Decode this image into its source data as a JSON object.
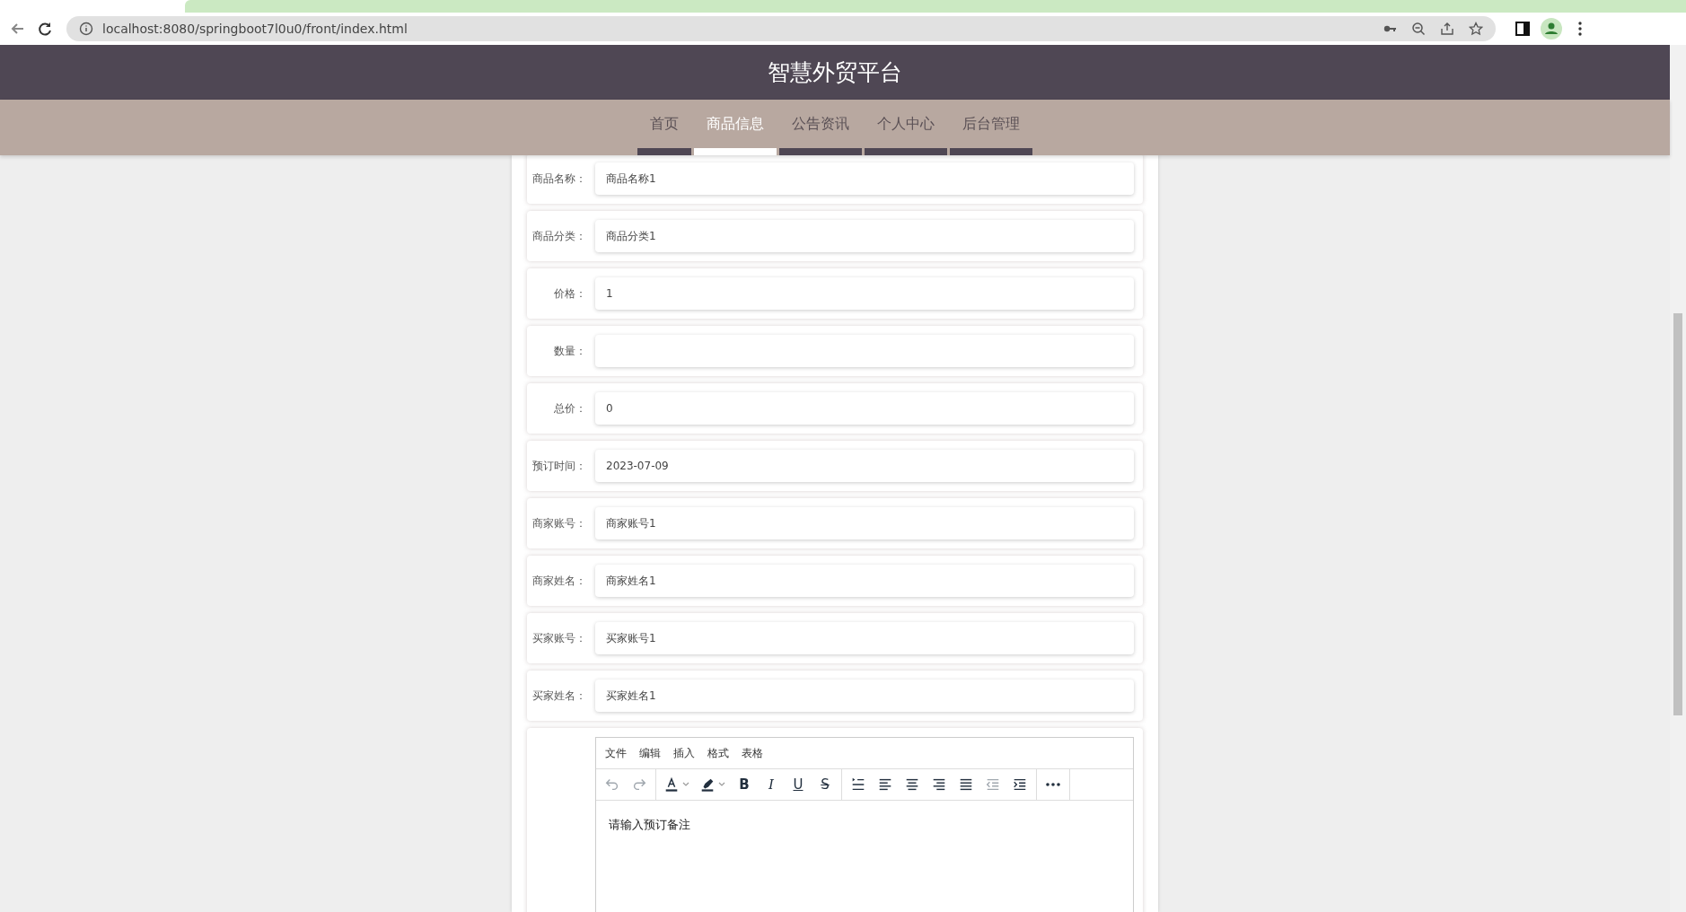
{
  "browser": {
    "url": "localhost:8080/springboot7l0u0/front/index.html"
  },
  "header": {
    "title": "智慧外贸平台"
  },
  "nav": [
    {
      "label": "首页",
      "selected": false
    },
    {
      "label": "商品信息",
      "selected": true
    },
    {
      "label": "公告资讯",
      "selected": false
    },
    {
      "label": "个人中心",
      "selected": false
    },
    {
      "label": "后台管理",
      "selected": false
    }
  ],
  "form": {
    "fields": [
      {
        "label": "商品名称：",
        "value": "商品名称1"
      },
      {
        "label": "商品分类：",
        "value": "商品分类1"
      },
      {
        "label": "价格：",
        "value": "1"
      },
      {
        "label": "数量："
      },
      {
        "label": "总价：",
        "value": "0"
      },
      {
        "label": "预订时间：",
        "value": "2023-07-09"
      },
      {
        "label": "商家账号：",
        "value": "商家账号1"
      },
      {
        "label": "商家姓名：",
        "value": "商家姓名1"
      },
      {
        "label": "买家账号：",
        "value": "买家账号1"
      },
      {
        "label": "买家姓名：",
        "value": "买家姓名1"
      }
    ],
    "editor": {
      "menus": [
        "文件",
        "编辑",
        "插入",
        "格式",
        "表格"
      ],
      "groups": [
        {
          "tools": [
            {
              "kind": "undo",
              "disabled": true
            },
            {
              "kind": "redo",
              "disabled": true
            }
          ]
        },
        {
          "tools": [
            {
              "kind": "text-color",
              "disabled": false
            },
            {
              "kind": "highlight",
              "disabled": false
            },
            {
              "kind": "bold",
              "glyph": "B",
              "disabled": false
            },
            {
              "kind": "italic",
              "glyph": "I",
              "disabled": false
            },
            {
              "kind": "underline",
              "glyph": "U",
              "disabled": false
            },
            {
              "kind": "strike",
              "glyph": "S",
              "disabled": false
            }
          ]
        },
        {
          "tools": [
            {
              "kind": "line-height",
              "disabled": false
            },
            {
              "kind": "align-left",
              "disabled": false
            },
            {
              "kind": "align-center",
              "disabled": false
            },
            {
              "kind": "align-right",
              "disabled": false
            },
            {
              "kind": "justify",
              "disabled": false
            },
            {
              "kind": "outdent",
              "disabled": true
            },
            {
              "kind": "indent",
              "disabled": false
            }
          ]
        },
        {
          "tools": [
            {
              "kind": "more",
              "disabled": false
            }
          ]
        }
      ],
      "placeholder": "请输入预订备注"
    }
  }
}
